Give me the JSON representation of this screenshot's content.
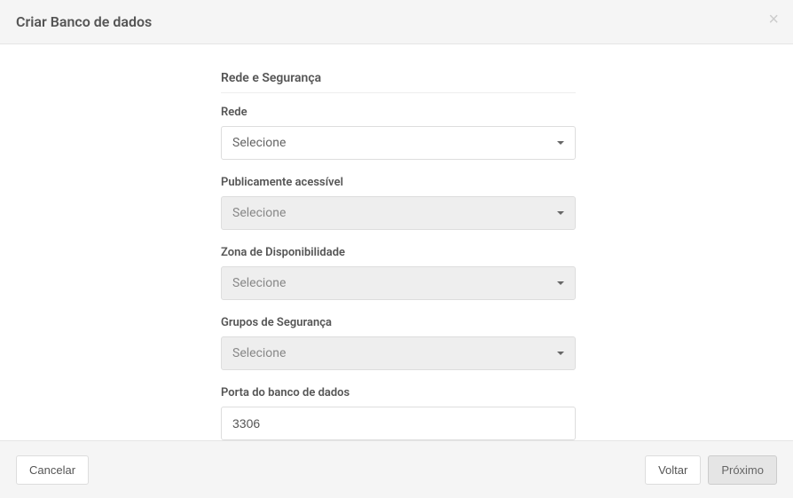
{
  "header": {
    "title": "Criar Banco de dados",
    "close": "×"
  },
  "form": {
    "section_title": "Rede e Segurança",
    "network": {
      "label": "Rede",
      "value": "Selecione"
    },
    "publicly_accessible": {
      "label": "Publicamente acessível",
      "value": "Selecione"
    },
    "availability_zone": {
      "label": "Zona de Disponibilidade",
      "value": "Selecione"
    },
    "security_groups": {
      "label": "Grupos de Segurança",
      "value": "Selecione"
    },
    "db_port": {
      "label": "Porta do banco de dados",
      "value": "3306"
    }
  },
  "footer": {
    "cancel": "Cancelar",
    "back": "Voltar",
    "next": "Próximo"
  }
}
